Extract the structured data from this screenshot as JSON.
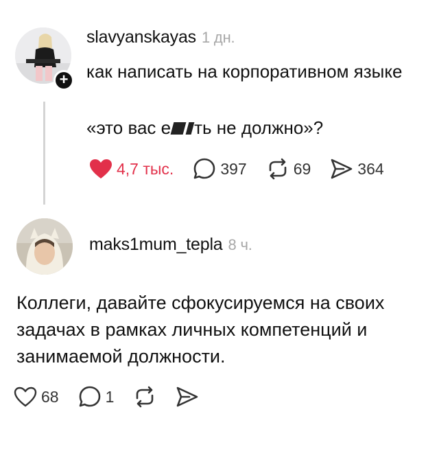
{
  "post1": {
    "username": "slavyanskayas",
    "time_ago": "1 дн.",
    "text_line1": "как написать на корпоративном языке",
    "text_line2_before": "«это вас е",
    "text_line2_after": "ть не должно»?",
    "likes": "4,7 тыс.",
    "replies": "397",
    "reposts": "69",
    "shares": "364",
    "like_color": "#e2304a",
    "icons": [
      "heart-filled-icon",
      "comment-icon",
      "repost-icon",
      "share-icon",
      "plus-icon"
    ]
  },
  "post2": {
    "username": "maks1mum_tepla",
    "time_ago": "8 ч.",
    "text": "Коллеги, давайте сфокусируемся на своих задачах в рамках личных компетенций и занимаемой должности.",
    "likes": "68",
    "replies": "1",
    "icons": [
      "heart-outline-icon",
      "comment-icon",
      "repost-icon",
      "share-icon"
    ]
  }
}
